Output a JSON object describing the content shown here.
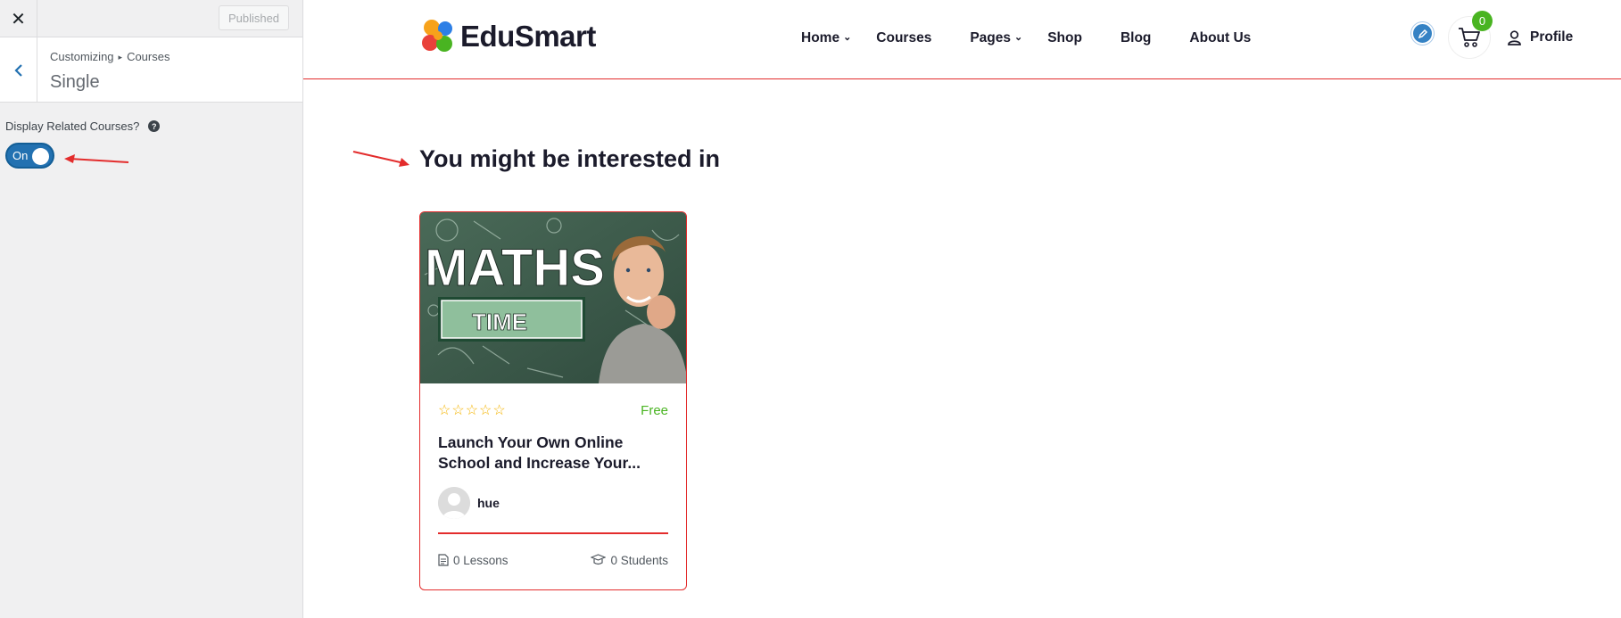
{
  "customizer": {
    "close_glyph": "✕",
    "published_label": "Published",
    "breadcrumb": {
      "root": "Customizing",
      "separator": "▸",
      "current": "Courses"
    },
    "section_title": "Single",
    "control_label": "Display Related Courses?",
    "help_glyph": "?",
    "toggle_label": "On",
    "toggle_color": "#2271b1"
  },
  "site": {
    "logo_text": "EduSmart",
    "nav": [
      {
        "label": "Home",
        "dropdown": true
      },
      {
        "label": "Courses",
        "dropdown": false
      },
      {
        "label": "Pages",
        "dropdown": true
      },
      {
        "label": "Shop",
        "dropdown": false
      },
      {
        "label": "Blog",
        "dropdown": false
      },
      {
        "label": "About Us",
        "dropdown": false
      }
    ],
    "cart_count": "0",
    "profile_label": "Profile",
    "accent_color": "#e32c2c"
  },
  "related": {
    "heading": "You might be interested in",
    "card": {
      "thumb_text_1": "MATHS",
      "thumb_text_2": "TIME",
      "rating_stars": "☆☆☆☆☆",
      "price": "Free",
      "title": "Launch Your Own Online School and Increase Your...",
      "author": "hue",
      "lessons": "0 Lessons",
      "students": "0 Students"
    }
  }
}
